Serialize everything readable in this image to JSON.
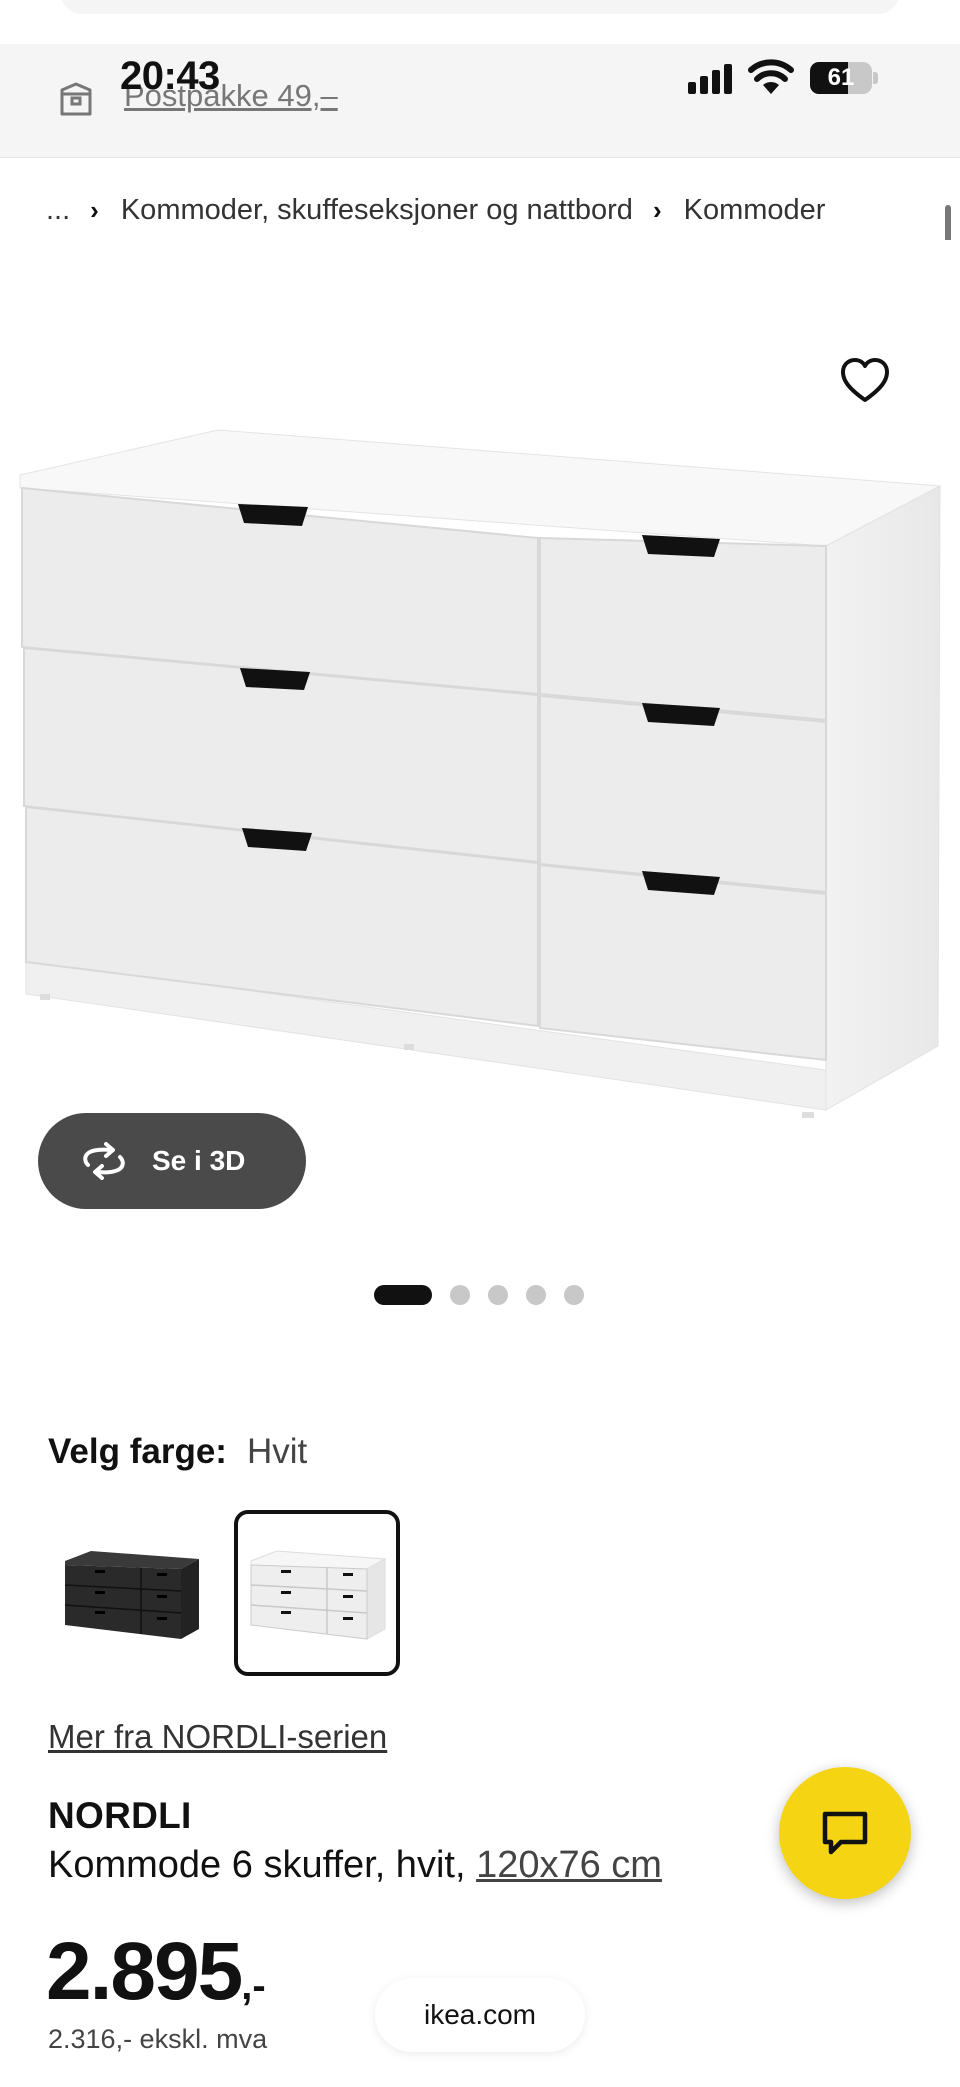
{
  "status_bar": {
    "time": "20:43",
    "battery_level": "61",
    "battery_fraction": 0.61
  },
  "shipping": {
    "icon": "package-icon",
    "label": "Postpakke 49,–"
  },
  "breadcrumb": {
    "items": [
      "...",
      "Kommoder, skuffeseksjoner og nattbord",
      "Kommoder"
    ]
  },
  "gallery": {
    "view_3d_label": "Se i 3D",
    "slide_count": 5,
    "active_slide": 1,
    "favorite_icon": "heart-icon"
  },
  "color_selector": {
    "label": "Velg farge:",
    "selected": "Hvit",
    "options": [
      {
        "name": "black",
        "selected": false,
        "color": "#2a2a2a"
      },
      {
        "name": "white",
        "selected": true,
        "color": "#f0f0f0"
      }
    ]
  },
  "product": {
    "series_link": "Mer fra NORDLI-serien",
    "name": "NORDLI",
    "description": "Kommode 6 skuffer, hvit, ",
    "size": "120x76 cm",
    "price_main": "2.895",
    "price_decimals": ",-",
    "price_ex_vat": "2.316,- ekskl. mva"
  },
  "browser": {
    "url": "ikea.com"
  },
  "colors": {
    "chat_button": "#f5d414",
    "dark_button": "#4a4a4a",
    "header_bg": "#f5f5f5"
  }
}
